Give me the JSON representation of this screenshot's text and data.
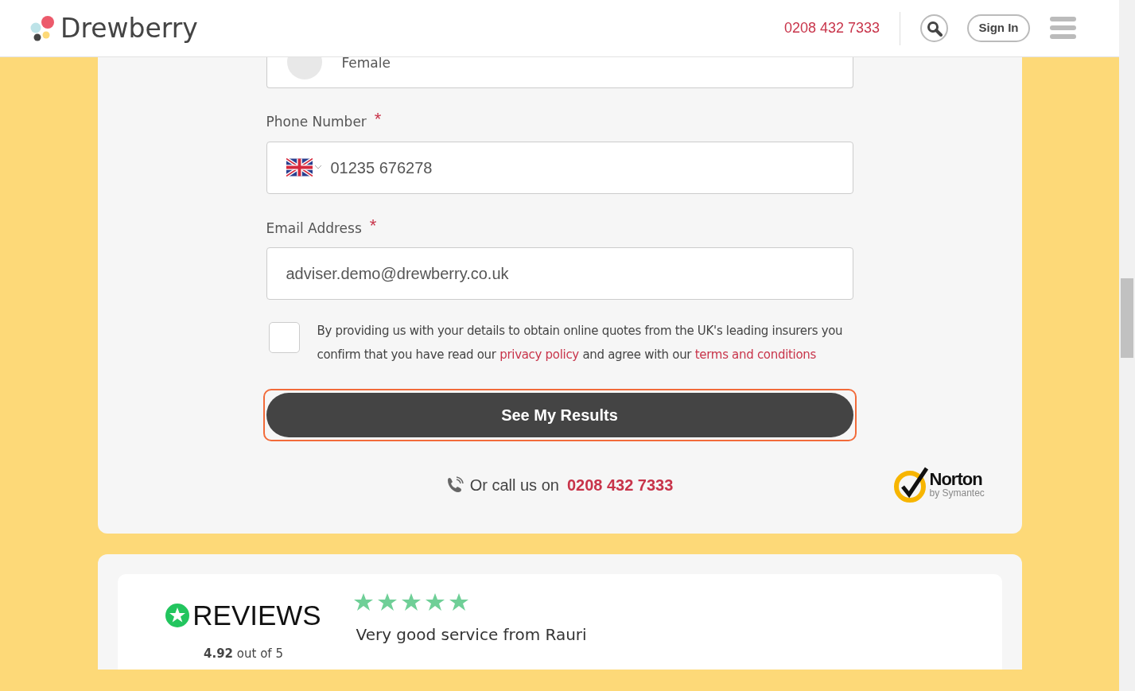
{
  "header": {
    "logo_text": "Drewberry",
    "phone": "0208 432 7333",
    "sign_in": "Sign In"
  },
  "form": {
    "gender_option": {
      "label": "Female",
      "selected": false
    },
    "fields": [
      {
        "kind": "phone",
        "label": "Phone Number",
        "required_mark": "*",
        "value": "01235 676278"
      },
      {
        "kind": "email",
        "label": "Email Address",
        "required_mark": "*",
        "value": "adviser.demo@drewberry.co.uk"
      }
    ],
    "consent": {
      "checked": false,
      "parts": [
        {
          "kind": "text",
          "text": "By providing us with your details to obtain online quotes from the UK's leading insurers you confirm that you have read our"
        },
        {
          "kind": "link",
          "text": "privacy policy"
        },
        {
          "kind": "text",
          "text": "and agree with our"
        },
        {
          "kind": "link",
          "text": "terms and conditions"
        }
      ]
    },
    "submit": "See My Results",
    "call": {
      "prefix": "Or call us on",
      "phone": "0208 432 7333"
    },
    "badge": {
      "name": "Norton",
      "sub": "by Symantec"
    }
  },
  "reviews": {
    "logo_text": "REVIEWS",
    "rating": "**4.92** out of 5",
    "stars": 5,
    "title": "Very good service from Rauri"
  }
}
